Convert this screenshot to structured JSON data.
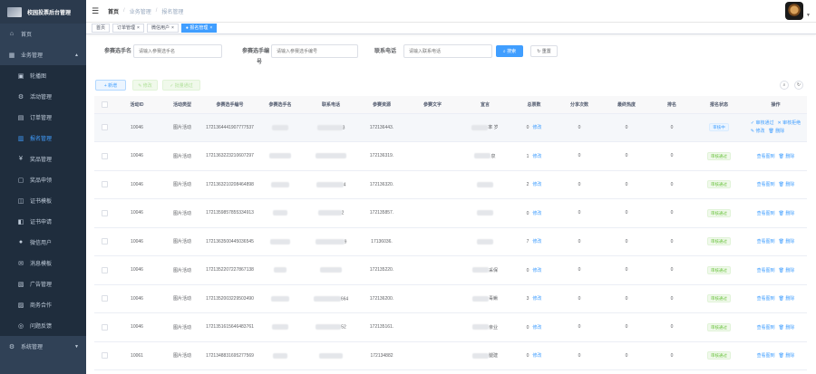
{
  "app": {
    "title": "校园投票后台管理"
  },
  "sidebar": {
    "items": [
      {
        "label": "首页",
        "icon": "home-icon",
        "kind": "top"
      },
      {
        "label": "业务管理",
        "icon": "grid-icon",
        "kind": "top",
        "arrow": "▲"
      },
      {
        "label": "轮播图",
        "icon": "image-icon",
        "kind": "sub"
      },
      {
        "label": "活动管理",
        "icon": "gear-icon",
        "kind": "sub"
      },
      {
        "label": "订单管理",
        "icon": "cart-icon",
        "kind": "sub"
      },
      {
        "label": "报名管理",
        "icon": "document-icon",
        "kind": "sub",
        "active": true
      },
      {
        "label": "奖品管理",
        "icon": "yen-icon",
        "kind": "sub"
      },
      {
        "label": "奖品申领",
        "icon": "clipboard-icon",
        "kind": "sub"
      },
      {
        "label": "证书模板",
        "icon": "certificate-icon",
        "kind": "sub"
      },
      {
        "label": "证书申请",
        "icon": "certificate-apply-icon",
        "kind": "sub"
      },
      {
        "label": "微信用户",
        "icon": "user-icon",
        "kind": "sub"
      },
      {
        "label": "消息模板",
        "icon": "message-icon",
        "kind": "sub"
      },
      {
        "label": "广告管理",
        "icon": "ad-icon",
        "kind": "sub"
      },
      {
        "label": "商务合作",
        "icon": "cooperation-icon",
        "kind": "sub"
      },
      {
        "label": "问题反馈",
        "icon": "feedback-icon",
        "kind": "sub"
      },
      {
        "label": "系统管理",
        "icon": "system-icon",
        "kind": "top",
        "arrow": "▼"
      }
    ]
  },
  "header": {
    "breadcrumb": [
      "首页",
      "业务管理",
      "报名管理"
    ],
    "avatar_caret": "▼"
  },
  "tags": [
    {
      "label": "首页",
      "active": false,
      "closable": false
    },
    {
      "label": "订单管理",
      "active": false,
      "closable": true
    },
    {
      "label": "微信用户",
      "active": false,
      "closable": true
    },
    {
      "label": "报名管理",
      "active": true,
      "closable": true
    }
  ],
  "search": {
    "name_label": "参赛选手名",
    "name_placeholder": "请输入参赛选手名",
    "no_label_line1": "参赛选手编",
    "no_label_line2": "号",
    "no_placeholder": "请输入参赛选手编号",
    "phone_label": "联系电话",
    "phone_placeholder": "请输入联系电话",
    "search_btn": "搜索",
    "reset_btn": "重置"
  },
  "toolbar": {
    "add": "+ 新增",
    "edit": "✎ 修改",
    "batch_approve": "✓ 批量通过"
  },
  "table": {
    "columns": [
      "",
      "活动ID",
      "活动类型",
      "参赛选手编号",
      "参赛选手名",
      "联系电话",
      "参赛资源",
      "参赛文字",
      "宣言",
      "总票数",
      "分享次数",
      "最终热度",
      "排名",
      "报名状态",
      "操作"
    ],
    "edit_label": "修改",
    "view_label": "查看图到",
    "delete_label": "删除",
    "approve_label": "审核通过",
    "reject_label": "审核拒绝",
    "rows": [
      {
        "aid": "10046",
        "type": "图片活动",
        "no": "1721364441907777537",
        "phone_tail": "3",
        "res": "172136443.",
        "decl": "率 岁",
        "votes": "0",
        "share": "0",
        "heat": "0",
        "rank": "0",
        "status": "审核中",
        "pending": true
      },
      {
        "aid": "10046",
        "type": "图片活动",
        "no": "1721363223210607297",
        "phone_tail": "",
        "res": "172136319.",
        "decl": "泉",
        "votes": "1",
        "share": "0",
        "heat": "0",
        "rank": "0",
        "status": "审核通过"
      },
      {
        "aid": "10046",
        "type": "图片活动",
        "no": "1721363210208464898",
        "phone_tail": "4",
        "res": "172136320.",
        "decl": "",
        "votes": "2",
        "share": "0",
        "heat": "0",
        "rank": "0",
        "status": "审核通过"
      },
      {
        "aid": "10046",
        "type": "图片活动",
        "no": "1721359857855334913",
        "phone_tail": "2",
        "res": "172135857.",
        "decl": "",
        "votes": "0",
        "share": "0",
        "heat": "0",
        "rank": "0",
        "status": "审核通过"
      },
      {
        "aid": "10046",
        "type": "图片活动",
        "no": "1721363500445036545",
        "phone_tail": "9",
        "res": "17136036.",
        "decl": "",
        "votes": "7",
        "share": "0",
        "heat": "0",
        "rank": "0",
        "status": "审核通过"
      },
      {
        "aid": "10046",
        "type": "图片活动",
        "no": "1721352207227867138",
        "phone_tail": "",
        "res": "172135220.",
        "decl": "采保",
        "votes": "0",
        "share": "0",
        "heat": "0",
        "rank": "0",
        "status": "审核通过"
      },
      {
        "aid": "10046",
        "type": "图片活动",
        "no": "1721352003229503490",
        "phone_tail": "664",
        "res": "172136200.",
        "decl": "毒鳅",
        "votes": "3",
        "share": "0",
        "heat": "0",
        "rank": "0",
        "status": "审核通过"
      },
      {
        "aid": "10046",
        "type": "图片活动",
        "no": "1721351615646483761",
        "phone_tail": "52",
        "res": "172135161.",
        "decl": "亲业",
        "votes": "0",
        "share": "0",
        "heat": "0",
        "rank": "0",
        "status": "审核通过"
      },
      {
        "aid": "10061",
        "type": "图片活动",
        "no": "1721348831695277569",
        "phone_tail": "",
        "res": "172134882",
        "decl": "腿建",
        "votes": "0",
        "share": "0",
        "heat": "0",
        "rank": "0",
        "status": "审核通过"
      }
    ]
  }
}
